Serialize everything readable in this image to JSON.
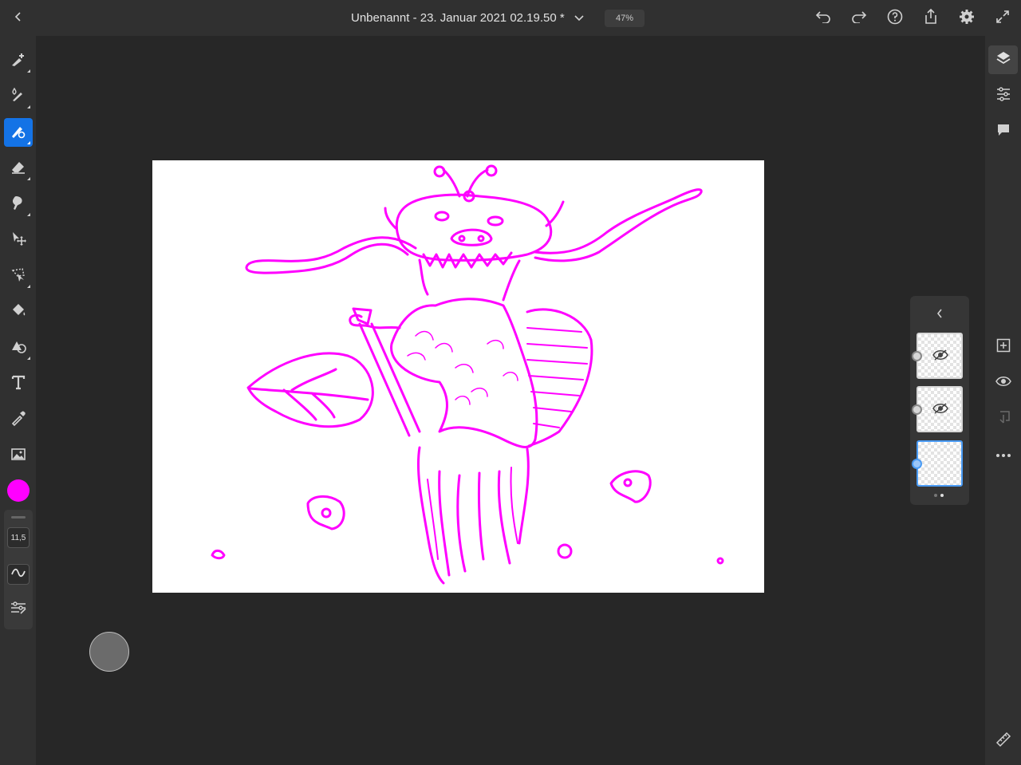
{
  "document": {
    "title": "Unbenannt - 23. Januar 2021 02.19.50 *",
    "zoom": "47%"
  },
  "topbar_icons": [
    "back-chevron-icon",
    "title-dropdown-icon",
    "undo-icon",
    "redo-icon",
    "help-icon",
    "share-icon",
    "settings-gear-icon",
    "fullscreen-icon"
  ],
  "left_toolbar": {
    "tools": [
      "pixel-brush",
      "live-brush",
      "vector-brush",
      "eraser",
      "smudge",
      "transform",
      "selection",
      "fill",
      "shapes",
      "text",
      "eyedropper",
      "image"
    ],
    "active_tool": "vector-brush",
    "current_color": "#ff00ff",
    "brush_size": "11,5"
  },
  "right_toolbar": {
    "icons": [
      "layers-icon",
      "layer-properties-icon",
      "comments-icon",
      "add-layer-icon",
      "visibility-eye-icon",
      "merge-down-icon",
      "more-icon",
      "ruler-icon"
    ]
  },
  "layers_panel": {
    "layers": [
      {
        "name": "layer-1",
        "hidden": true,
        "selected": false
      },
      {
        "name": "layer-2",
        "hidden": true,
        "selected": false
      },
      {
        "name": "layer-3",
        "hidden": false,
        "selected": true
      }
    ],
    "pages": 2,
    "current_page": 2
  },
  "colors": {
    "accent": "#1473e6",
    "stroke": "#ff00ff",
    "ui_background": "#272727",
    "panel": "#303030"
  }
}
